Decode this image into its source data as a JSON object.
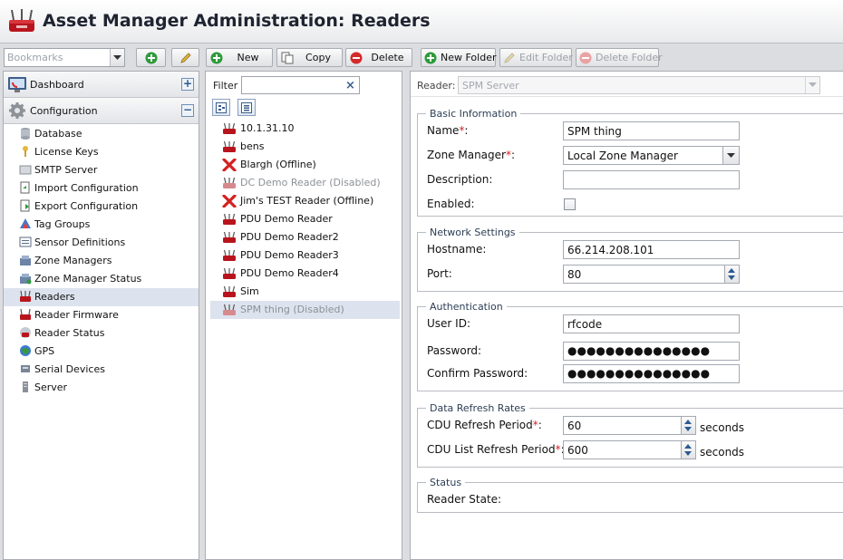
{
  "app": {
    "title": "Asset Manager Administration: Readers"
  },
  "toolbar": {
    "bookmarks_placeholder": "Bookmarks",
    "new_label": "New",
    "copy_label": "Copy",
    "delete_label": "Delete",
    "new_folder_label": "New Folder",
    "edit_folder_label": "Edit Folder",
    "delete_folder_label": "Delete Folder"
  },
  "nav": {
    "dashboard_label": "Dashboard",
    "dashboard_toggle": "+",
    "configuration_label": "Configuration",
    "configuration_toggle": "−",
    "items": [
      {
        "label": "Database",
        "icon": "database-icon"
      },
      {
        "label": "License Keys",
        "icon": "key-icon"
      },
      {
        "label": "SMTP Server",
        "icon": "smtp-icon"
      },
      {
        "label": "Import Configuration",
        "icon": "import-icon"
      },
      {
        "label": "Export Configuration",
        "icon": "export-icon"
      },
      {
        "label": "Tag Groups",
        "icon": "tag-groups-icon"
      },
      {
        "label": "Sensor Definitions",
        "icon": "sensor-definitions-icon"
      },
      {
        "label": "Zone Managers",
        "icon": "zone-managers-icon"
      },
      {
        "label": "Zone Manager Status",
        "icon": "zone-status-icon"
      },
      {
        "label": "Readers",
        "icon": "reader-icon",
        "selected": true
      },
      {
        "label": "Reader Firmware",
        "icon": "firmware-icon"
      },
      {
        "label": "Reader Status",
        "icon": "reader-status-icon"
      },
      {
        "label": "GPS",
        "icon": "gps-icon"
      },
      {
        "label": "Serial Devices",
        "icon": "serial-devices-icon"
      },
      {
        "label": "Server",
        "icon": "server-icon"
      }
    ]
  },
  "list": {
    "filter_label": "Filter",
    "filter_value": "",
    "readers": [
      {
        "label": "10.1.31.10",
        "status": "ok"
      },
      {
        "label": "bens",
        "status": "ok"
      },
      {
        "label": "Blargh (Offline)",
        "status": "offline"
      },
      {
        "label": "DC Demo Reader (Disabled)",
        "status": "disabled"
      },
      {
        "label": "Jim's TEST Reader (Offline)",
        "status": "offline"
      },
      {
        "label": "PDU Demo Reader",
        "status": "ok"
      },
      {
        "label": "PDU Demo Reader2",
        "status": "ok"
      },
      {
        "label": "PDU Demo Reader3",
        "status": "ok"
      },
      {
        "label": "PDU Demo Reader4",
        "status": "ok"
      },
      {
        "label": "Sim",
        "status": "ok"
      },
      {
        "label": "SPM thing (Disabled)",
        "status": "disabled",
        "selected": true
      }
    ]
  },
  "detail": {
    "reader_label": "Reader:",
    "reader_value": "SPM Server",
    "basic": {
      "legend": "Basic Information",
      "name_label": "Name",
      "name_value": "SPM thing",
      "zone_label": "Zone Manager",
      "zone_value": "Local Zone Manager",
      "description_label": "Description:",
      "description_value": "",
      "enabled_label": "Enabled:",
      "enabled": false
    },
    "network": {
      "legend": "Network Settings",
      "hostname_label": "Hostname:",
      "hostname_value": "66.214.208.101",
      "port_label": "Port:",
      "port_value": "80"
    },
    "auth": {
      "legend": "Authentication",
      "userid_label": "User ID:",
      "userid_value": "rfcode",
      "password_label": "Password:",
      "password_value": "●●●●●●●●●●●●●●●",
      "confirm_label": "Confirm Password:",
      "confirm_value": "●●●●●●●●●●●●●●●"
    },
    "refresh": {
      "legend": "Data Refresh Rates",
      "cdu_label": "CDU Refresh Period",
      "cdu_value": "60",
      "cdu_list_label": "CDU List Refresh Period",
      "cdu_list_value": "600",
      "units": "seconds"
    },
    "status": {
      "legend": "Status",
      "state_label": "Reader State:",
      "state_value": ""
    },
    "required_mark": "*",
    "colon": ":"
  },
  "colors": {
    "accent": "#2c5a91",
    "required": "#d4202a",
    "selection": "#dde3ee",
    "brand_red": "#b8141d"
  }
}
